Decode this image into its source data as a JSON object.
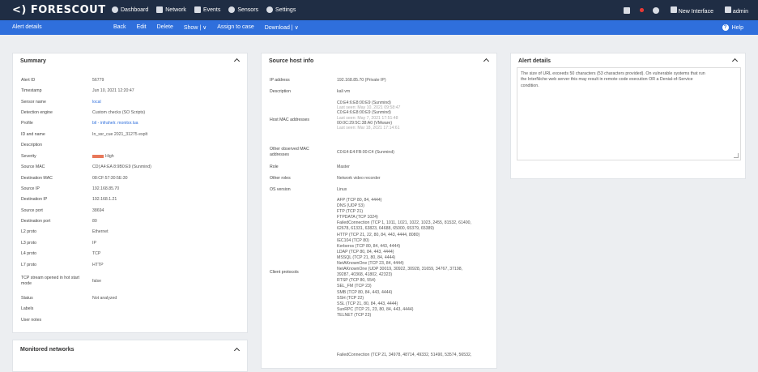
{
  "brand": {
    "name": "<) FORESCOUT"
  },
  "nav": [
    {
      "label": "Dashboard",
      "icon": "dashboard-icon"
    },
    {
      "label": "Network",
      "icon": "network-icon"
    },
    {
      "label": "Events",
      "icon": "events-icon"
    },
    {
      "label": "Sensors",
      "icon": "sensors-icon"
    },
    {
      "label": "Settings",
      "icon": "settings-icon"
    }
  ],
  "topright": {
    "new_interface": "New Interface",
    "user": "admin"
  },
  "toolbar": {
    "title": "Alert details",
    "actions": [
      "Back",
      "Edit",
      "Delete",
      "Show | ∨",
      "Assign to case",
      "Download | ∨"
    ],
    "help": "Help"
  },
  "summary": {
    "title": "Summary",
    "rows": [
      {
        "k": "Alert ID",
        "v": "56779"
      },
      {
        "k": "Timestamp",
        "v": "Jun 10, 2021 12:20:47"
      },
      {
        "k": "Sensor name",
        "v": "local"
      },
      {
        "k": "Detection engine",
        "v": "Custom checks (SO Scripts)"
      },
      {
        "k": "Profile",
        "v": "bil - infrahelr. monitor.lua"
      },
      {
        "k": "ID and name",
        "v": "In_ssr_cue 2021_31275 explt"
      },
      {
        "k": "Description",
        "v": ""
      },
      {
        "k": "Severity",
        "v": "High"
      },
      {
        "k": "Source MAC",
        "v": "CD|:A4:EA 8:9B0:E9 (Sunmind)"
      },
      {
        "k": "Destination MAC",
        "v": "08:CF:57:30:5E:30"
      },
      {
        "k": "Source IP",
        "v": "192.168.85.70"
      },
      {
        "k": "Destination IP",
        "v": "192.168.1.21"
      },
      {
        "k": "Source port",
        "v": "38694"
      },
      {
        "k": "Destination port",
        "v": "80"
      },
      {
        "k": "L2 proto",
        "v": "Ethernet"
      },
      {
        "k": "L3 proto",
        "v": "IP"
      },
      {
        "k": "L4 proto",
        "v": "TCP"
      },
      {
        "k": "L7 proto",
        "v": "HTTP"
      },
      {
        "k": "TCP stream opened in hot start mode",
        "v": "false"
      },
      {
        "k": "Status",
        "v": "Not analyzed"
      },
      {
        "k": "Labels",
        "v": ""
      },
      {
        "k": "User notes",
        "v": ""
      }
    ]
  },
  "monitored": {
    "title": "Monitored networks"
  },
  "source": {
    "title": "Source host info",
    "ip_label": "IP address",
    "ip": "192.168.85.70 (Private IP)",
    "desc_label": "Description",
    "desc": "kali vm",
    "mac_label": "Host MAC addresses",
    "macs": [
      {
        "addr": "C0:E4:6:E8:00:E9 (Sunmind)",
        "seen": "Last seen: May 10, 2021 09:58:47"
      },
      {
        "addr": "C0:E4:6:E8:00:E9 (Sunmind)",
        "seen": "Last seen: May 7, 2021 17:51:48"
      },
      {
        "addr": "00:0C:29:5C:38:A0 (VMware)",
        "seen": "Last seen: Mar 18, 2021 17:14:61"
      }
    ],
    "other_mac_label": "Other observed MAC addresses",
    "other_mac": "C0:E4:E4:FB:00:C4 (Sunmind)",
    "role_label": "Role",
    "role": "Master",
    "other_roles_label": "Other roles",
    "other_roles": "Network video recorder",
    "os_label": "OS version",
    "os": "Linux",
    "protocols_label": "Client protocols",
    "protocols": [
      "AFP (TCP 80, 84, 4444)",
      "DNS (UDP 53)",
      "FTP (TCP 21)",
      "FTPDATA (TCP 1024)",
      "FailedConnection (TCP 1, 1011, 1021, 1022, 1023, 2455, 81532, 61400,",
      "62678, 61331, 63823, 64688, 65000, 65379, 65389)",
      "HTTP (TCP 21, 22, 80, 84, 443, 4444, 8080)",
      "IEC104 (TCP 80)",
      "Kerberos (TCP 80, 84, 443, 4444)",
      "LDAP (TCP 80, 84, 443, 4444)",
      "MSSQL (TCP 21, 80, 84, 4444)",
      "NetAKnownOne (TCP 23, 84, 4444)",
      "NetAKnownOne (UDP 30019, 30922, 30928, 31659, 34767, 37198,",
      "39287, 40368, 41802, 42323)",
      "RTSP (TCP 80, 554)",
      "SEL_FM (TCP 23)",
      "SMB (TCP 80, 84, 443, 4444)",
      "SSH (TCP 22)",
      "SSL (TCP 21, 80, 84, 443, 4444)",
      "SunRPC (TCP 21, 23, 80, 84, 443, 4444)",
      "TELNET (TCP 23)"
    ],
    "failed": "FailedConnection (TCP 21, 34978, 48714, 49332, 51490, 53574, 56532,"
  },
  "alert": {
    "title": "Alert details",
    "text_lines": [
      "The size of URL exceeds 50 characters (53 characters provided). On vulnerable systems that run",
      "the InterNiche web server this may result in remote code execution OR a Denial-of-Service",
      "condition."
    ]
  },
  "colors": {
    "topbar": "#1f2d44",
    "toolbar": "#2f6fdc",
    "severity": "#e8785a"
  }
}
